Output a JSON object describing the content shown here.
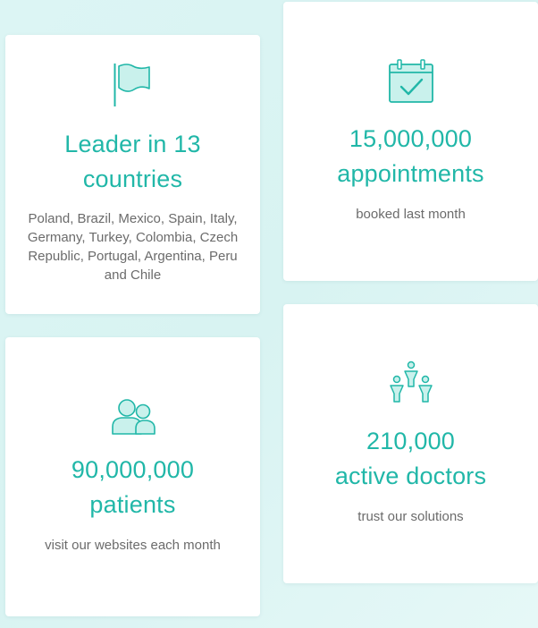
{
  "accent_color": "#21b7a8",
  "cards": [
    {
      "icon": "flag-icon",
      "headline_line1": "Leader in 13",
      "headline_line2": "countries",
      "description": "Poland, Brazil, Mexico, Spain, Italy, Germany, Turkey, Colombia, Czech Republic, Portugal, Argentina, Peru and Chile"
    },
    {
      "icon": "calendar-check-icon",
      "headline_line1": "15,000,000",
      "headline_line2": "appointments",
      "description": "booked last month"
    },
    {
      "icon": "patients-icon",
      "headline_line1": "90,000,000",
      "headline_line2": "patients",
      "description": "visit our websites each month"
    },
    {
      "icon": "doctors-network-icon",
      "headline_line1": "210,000",
      "headline_line2": "active doctors",
      "description": "trust our solutions"
    }
  ]
}
